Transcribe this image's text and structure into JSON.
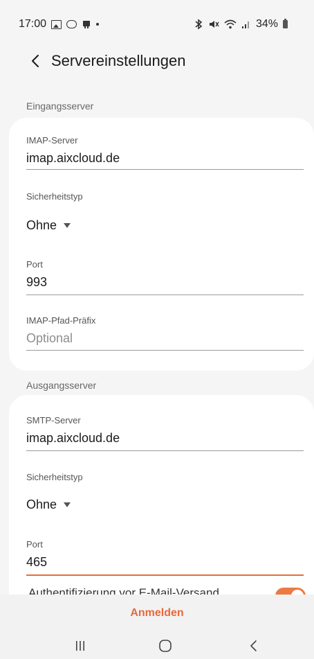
{
  "status_bar": {
    "time": "17:00",
    "battery": "34%"
  },
  "app_bar": {
    "title": "Servereinstellungen"
  },
  "incoming": {
    "section_label": "Eingangsserver",
    "server_label": "IMAP-Server",
    "server_value": "imap.aixcloud.de",
    "security_label": "Sicherheitstyp",
    "security_value": "Ohne",
    "port_label": "Port",
    "port_value": "993",
    "prefix_label": "IMAP-Pfad-Präfix",
    "prefix_placeholder": "Optional"
  },
  "outgoing": {
    "section_label": "Ausgangsserver",
    "server_label": "SMTP-Server",
    "server_value": "imap.aixcloud.de",
    "security_label": "Sicherheitstyp",
    "security_value": "Ohne",
    "port_label": "Port",
    "port_value": "465",
    "auth_label_partial": "Authentifizierung vor E-Mail-Versand",
    "auth_toggle_on": true
  },
  "action": {
    "sign_in_label": "Anmelden"
  },
  "colors": {
    "accent": "#e8693a",
    "background": "#f5f5f5",
    "card": "#ffffff"
  },
  "icons": {
    "back": "chevron-left-icon",
    "nav_recents": "recents-icon",
    "nav_home": "home-icon",
    "nav_back": "back-icon"
  }
}
